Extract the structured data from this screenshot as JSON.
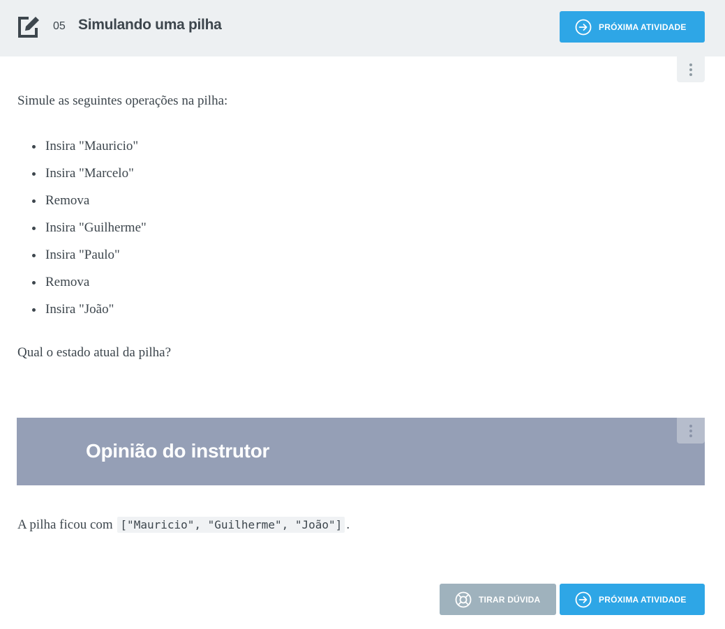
{
  "header": {
    "task_number": "05",
    "title": "Simulando uma pilha",
    "next_button_label": "PRÓXIMA ATIVIDADE"
  },
  "task": {
    "intro": "Simule as seguintes operações na pilha:",
    "operations": [
      "Insira \"Mauricio\"",
      "Insira \"Marcelo\"",
      "Remova",
      "Insira \"Guilherme\"",
      "Insira \"Paulo\"",
      "Remova",
      "Insira \"João\""
    ],
    "question": "Qual o estado atual da pilha?"
  },
  "opinion": {
    "title": "Opinião do instrutor",
    "answer_prefix": "A pilha ficou com",
    "answer_code": "[\"Mauricio\", \"Guilherme\", \"João\"]",
    "answer_suffix": "."
  },
  "footer": {
    "doubt_button_label": "TIRAR DÚVIDA",
    "next_button_label": "PRÓXIMA ATIVIDADE"
  },
  "colors": {
    "primary": "#2ea6e6",
    "secondary": "#9fb2bd",
    "header_bg": "#edf0f2",
    "opinion_bg": "#959fb6",
    "text": "#3d464d"
  },
  "icons": {
    "header": "edit-square-icon",
    "next": "arrow-right-circle-icon",
    "doubt": "lifebuoy-icon",
    "menu": "kebab-menu-icon"
  }
}
